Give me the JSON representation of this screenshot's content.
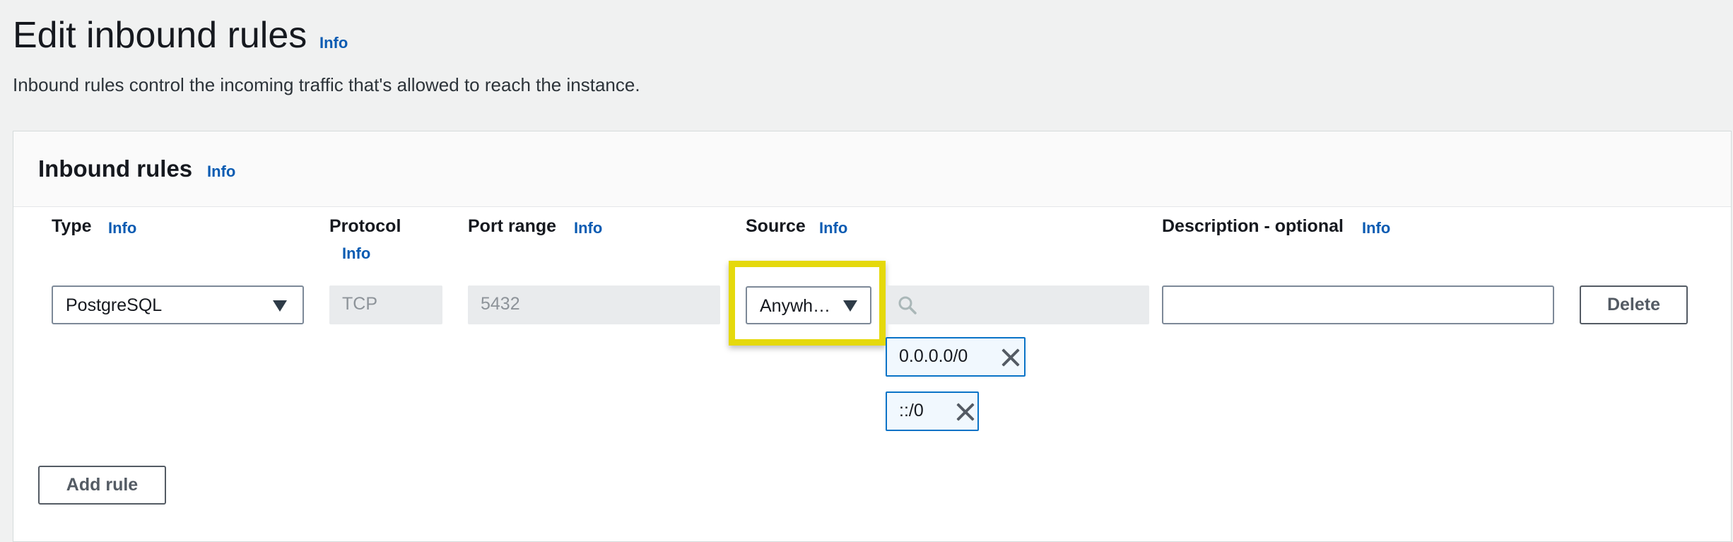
{
  "page": {
    "title": "Edit inbound rules",
    "info": "Info",
    "description": "Inbound rules control the incoming traffic that's allowed to reach the instance."
  },
  "panel": {
    "title": "Inbound rules",
    "info": "Info"
  },
  "columns": {
    "type": {
      "label": "Type",
      "info": "Info"
    },
    "protocol": {
      "label": "Protocol",
      "info": "Info"
    },
    "port_range": {
      "label": "Port range",
      "info": "Info"
    },
    "source": {
      "label": "Source",
      "info": "Info"
    },
    "description": {
      "label": "Description - optional",
      "info": "Info"
    }
  },
  "rule": {
    "type": "PostgreSQL",
    "protocol": "TCP",
    "port_range": "5432",
    "source_select": "Anywh…",
    "source_search_value": "",
    "source_tokens": [
      "0.0.0.0/0",
      "::/0"
    ],
    "description_value": "",
    "delete_label": "Delete"
  },
  "add_rule_label": "Add rule",
  "colors": {
    "highlight": "#e5d90c",
    "info_link": "#0a5bb2",
    "token_border": "#0a73c7",
    "token_bg": "#f1f8fe"
  },
  "icons": [
    "caret-down-icon",
    "search-icon",
    "close-icon"
  ]
}
